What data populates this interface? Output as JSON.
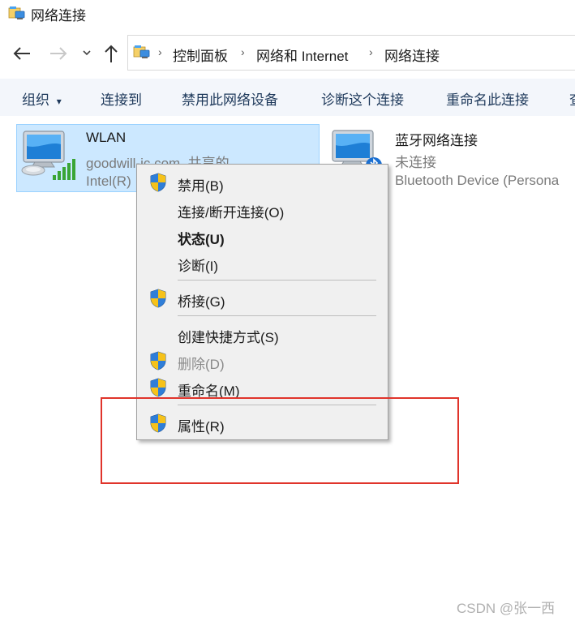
{
  "window": {
    "title": "网络连接"
  },
  "address": {
    "crumbs": [
      "控制面板",
      "网络和 Internet",
      "网络连接"
    ]
  },
  "toolbar": {
    "items": [
      "组织",
      "连接到",
      "禁用此网络设备",
      "诊断这个连接",
      "重命名此连接",
      "查"
    ],
    "organize_arrow": "▾"
  },
  "connections": [
    {
      "name": "WLAN",
      "status": "goodwill-ic.com. 共享的",
      "device": "Intel(R)",
      "selected": true
    },
    {
      "name": "蓝牙网络连接",
      "status": "未连接",
      "device": "Bluetooth Device (Persona",
      "selected": false
    }
  ],
  "context_menu": {
    "items": [
      {
        "label": "禁用(B)",
        "shield": true,
        "disabled": false,
        "bold": false
      },
      {
        "label": "连接/断开连接(O)",
        "shield": false,
        "disabled": false,
        "bold": false
      },
      {
        "label": "状态(U)",
        "shield": false,
        "disabled": false,
        "bold": true
      },
      {
        "label": "诊断(I)",
        "shield": false,
        "disabled": false,
        "bold": false
      },
      {
        "label": "桥接(G)",
        "shield": true,
        "disabled": false,
        "bold": false
      },
      {
        "label": "创建快捷方式(S)",
        "shield": false,
        "disabled": false,
        "bold": false
      },
      {
        "label": "删除(D)",
        "shield": true,
        "disabled": true,
        "bold": false
      },
      {
        "label": "重命名(M)",
        "shield": true,
        "disabled": false,
        "bold": false
      },
      {
        "label": "属性(R)",
        "shield": true,
        "disabled": false,
        "bold": false
      }
    ]
  },
  "watermark": "CSDN @张一西",
  "colors": {
    "selection": "#cce8ff",
    "highlight_box": "#e0342b",
    "toolbar_text": "#1e395b"
  }
}
